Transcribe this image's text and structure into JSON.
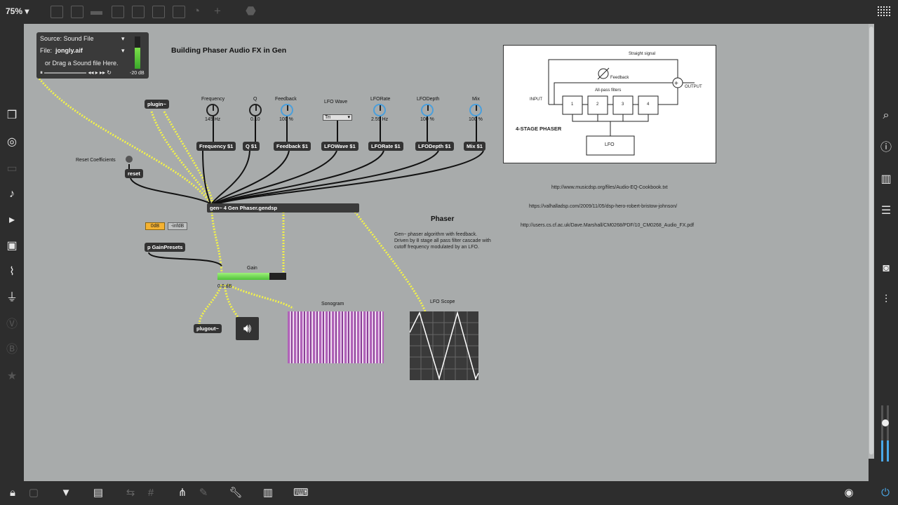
{
  "toolbar": {
    "zoom": "75%"
  },
  "canvas": {
    "title": "Building Phaser Audio FX in Gen",
    "player": {
      "source": "Source: Sound File",
      "file_label": "File:",
      "file_name": "jongly.aif",
      "drag_hint": "or Drag a Sound file Here.",
      "meter_value": "-20 dB"
    },
    "objects": {
      "plugin": "plugin~",
      "reset_label": "Reset Coefficients",
      "reset": "reset",
      "gen": "gen~ 4 Gen Phaser.gendsp",
      "preset_0db": "0dB",
      "preset_inf": "-infdB",
      "gain_presets": "p GainPresets",
      "gain_label": "Gain",
      "gain_value": "0.0 dB",
      "plugout": "plugout~",
      "sonogram_label": "Sonogram",
      "scope_label": "LFO Scope"
    },
    "params": [
      {
        "label": "Frequency",
        "value": "145 Hz",
        "msg": "Frequency $1"
      },
      {
        "label": "Q",
        "value": "0.10",
        "msg": "Q $1"
      },
      {
        "label": "Feedback",
        "value": "100 %",
        "msg": "Feedback $1"
      },
      {
        "label": "LFO Wave",
        "value": "Tri",
        "msg": "LFOWave $1"
      },
      {
        "label": "LFORate",
        "value": "2.59 Hz",
        "msg": "LFORate $1"
      },
      {
        "label": "LFODepth",
        "value": "100 %",
        "msg": "LFODepth $1"
      },
      {
        "label": "Mix",
        "value": "100 %",
        "msg": "Mix $1"
      }
    ],
    "diagram": {
      "straight": "Straight signal",
      "feedback": "Feedback",
      "allpass": "All-pass filters",
      "input": "INPUT",
      "output": "OUTPUT",
      "stages": [
        "1",
        "2",
        "3",
        "4"
      ],
      "caption": "4-STAGE PHASER",
      "lfo": "LFO"
    },
    "urls": [
      "http://www.musicdsp.org/files/Audio-EQ-Cookbook.txt",
      "https://valhalladsp.com/2009/11/05/dsp-hero-robert-bristow-johnson/",
      "http://users.cs.cf.ac.uk/Dave.Marshall/CM0268/PDF/10_CM0268_Audio_FX.pdf"
    ],
    "phaser_heading": "Phaser",
    "phaser_desc": "Gen~ phaser algorithm with feedback. Driven by 8 stage all pass filter cascade with cutoff frequency modulated by an LFO.",
    "gain_level": 0.76
  }
}
